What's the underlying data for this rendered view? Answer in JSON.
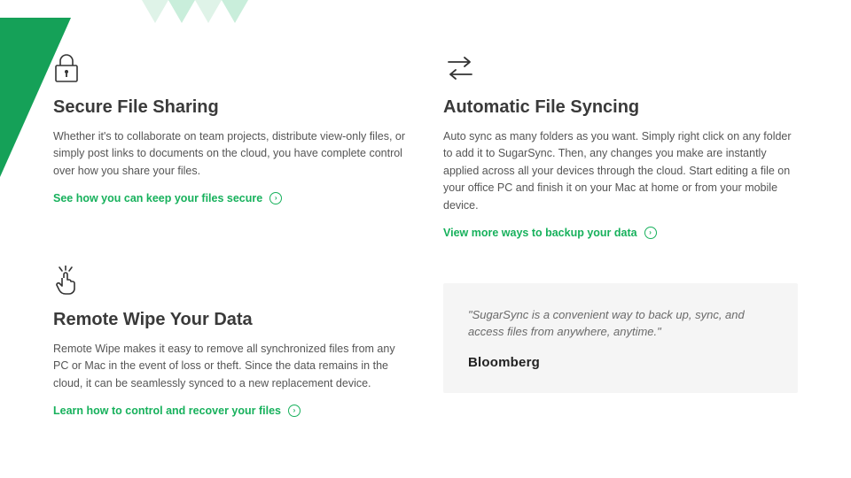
{
  "features": [
    {
      "title": "Secure File Sharing",
      "body": "Whether it's to collaborate on team projects, distribute view-only files, or simply post links to documents on the cloud, you have complete control over how you share your files.",
      "cta": "See how you can keep your files secure"
    },
    {
      "title": "Automatic File Syncing",
      "body": "Auto sync as many folders as you want. Simply right click on any folder to add it to SugarSync. Then, any changes you make are instantly applied across all your devices through the cloud. Start editing a file on your office PC and finish it on your Mac at home or from your mobile device.",
      "cta": "View more ways to backup your data"
    },
    {
      "title": "Remote Wipe Your Data",
      "body": "Remote Wipe makes it easy to remove all synchronized files from any PC or Mac in the event of loss or theft. Since the data remains in the cloud, it can be seamlessly synced to a new replacement device.",
      "cta": "Learn how to control and recover your files"
    }
  ],
  "quote": {
    "text": "\"SugarSync is a convenient way to back up, sync, and access files from anywhere, anytime.\"",
    "source": "Bloomberg"
  }
}
